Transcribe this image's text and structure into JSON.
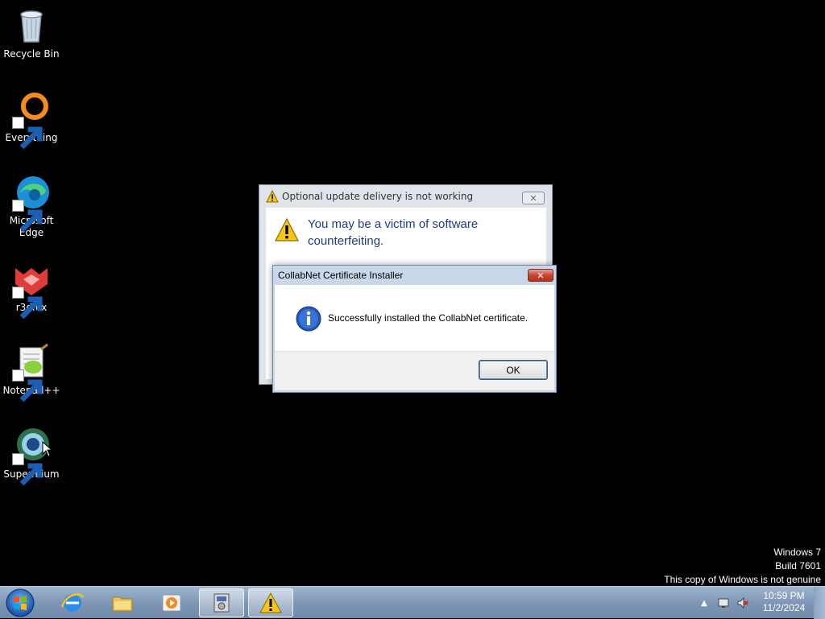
{
  "desktop": {
    "icons": [
      {
        "label": "Recycle Bin"
      },
      {
        "label": "Everything"
      },
      {
        "label": "Microsoft Edge"
      },
      {
        "label": "r3dfox"
      },
      {
        "label": "Notepad++"
      },
      {
        "label": "Supermium"
      }
    ],
    "watermark": {
      "line1": "Windows 7",
      "line2": "Build 7601",
      "line3": "This copy of Windows is not genuine"
    }
  },
  "dialog_bg": {
    "title": "Optional update delivery is not working",
    "instruction": "You may be a victim of software counterfeiting."
  },
  "dialog_fg": {
    "title": "CollabNet Certificate Installer",
    "message": "Successfully installed the CollabNet certificate.",
    "ok_label": "OK"
  },
  "taskbar": {
    "clock_time": "10:59 PM",
    "clock_date": "11/2/2024",
    "buttons": [
      "internet-explorer",
      "file-explorer",
      "media-player",
      "installer",
      "warning"
    ]
  },
  "colors": {
    "instruction": "#1e3a8a",
    "taskbar": "#7f97b5"
  }
}
